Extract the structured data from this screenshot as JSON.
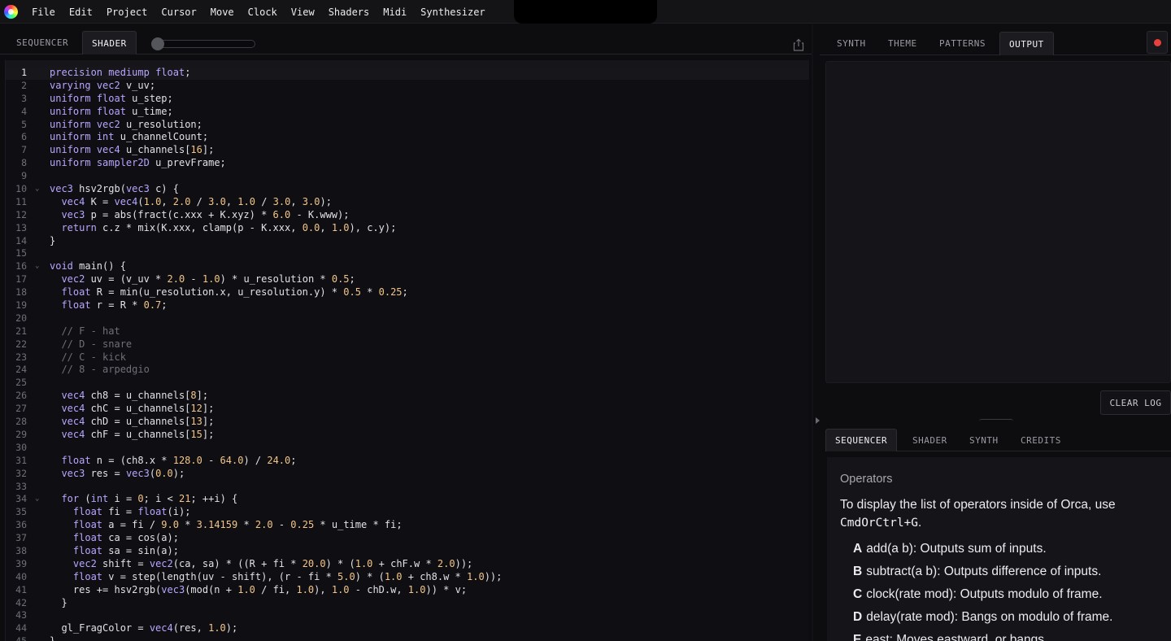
{
  "menu": [
    "File",
    "Edit",
    "Project",
    "Cursor",
    "Move",
    "Clock",
    "View",
    "Shaders",
    "Midi",
    "Synthesizer"
  ],
  "left_tabs": [
    "SEQUENCER",
    "SHADER"
  ],
  "right_tabs": [
    "SYNTH",
    "THEME",
    "PATTERNS",
    "OUTPUT"
  ],
  "clear_log_label": "CLEAR LOG",
  "bottom_tabs": [
    "SEQUENCER",
    "SHADER",
    "SYNTH",
    "CREDITS"
  ],
  "help": {
    "title": "Operators",
    "intro_text": "To display the list of operators inside of Orca, use",
    "intro_code": "CmdOrCtrl+G",
    "operators": [
      {
        "key": "A",
        "text": "add(a b): Outputs sum of inputs."
      },
      {
        "key": "B",
        "text": "subtract(a b): Outputs difference of inputs."
      },
      {
        "key": "C",
        "text": "clock(rate mod): Outputs modulo of frame."
      },
      {
        "key": "D",
        "text": "delay(rate mod): Bangs on modulo of frame."
      },
      {
        "key": "E",
        "text": "east: Moves eastward, or bangs."
      }
    ]
  },
  "editor": {
    "active_line": 1,
    "folds": [
      10,
      16,
      34
    ],
    "lines": [
      "precision mediump float;",
      "varying vec2 v_uv;",
      "uniform float u_step;",
      "uniform float u_time;",
      "uniform vec2 u_resolution;",
      "uniform int u_channelCount;",
      "uniform vec4 u_channels[16];",
      "uniform sampler2D u_prevFrame;",
      "",
      "vec3 hsv2rgb(vec3 c) {",
      "  vec4 K = vec4(1.0, 2.0 / 3.0, 1.0 / 3.0, 3.0);",
      "  vec3 p = abs(fract(c.xxx + K.xyz) * 6.0 - K.www);",
      "  return c.z * mix(K.xxx, clamp(p - K.xxx, 0.0, 1.0), c.y);",
      "}",
      "",
      "void main() {",
      "  vec2 uv = (v_uv * 2.0 - 1.0) * u_resolution * 0.5;",
      "  float R = min(u_resolution.x, u_resolution.y) * 0.5 * 0.25;",
      "  float r = R * 0.7;",
      "",
      "  // F - hat",
      "  // D - snare",
      "  // C - kick",
      "  // 8 - arpedgio",
      "",
      "  vec4 ch8 = u_channels[8];",
      "  vec4 chC = u_channels[12];",
      "  vec4 chD = u_channels[13];",
      "  vec4 chF = u_channels[15];",
      "",
      "  float n = (ch8.x * 128.0 - 64.0) / 24.0;",
      "  vec3 res = vec3(0.0);",
      "",
      "  for (int i = 0; i < 21; ++i) {",
      "    float fi = float(i);",
      "    float a = fi / 9.0 * 3.14159 * 2.0 - 0.25 * u_time * fi;",
      "    float ca = cos(a);",
      "    float sa = sin(a);",
      "    vec2 shift = vec2(ca, sa) * ((R + fi * 20.0) * (1.0 + chF.w * 2.0));",
      "    float v = step(length(uv - shift), (r - fi * 5.0) * (1.0 + ch8.w * 1.0));",
      "    res += hsv2rgb(vec3(mod(n + 1.0 / fi, 1.0), 1.0 - chD.w, 1.0)) * v;",
      "  }",
      "",
      "  gl_FragColor = vec4(res, 1.0);",
      "}"
    ]
  }
}
